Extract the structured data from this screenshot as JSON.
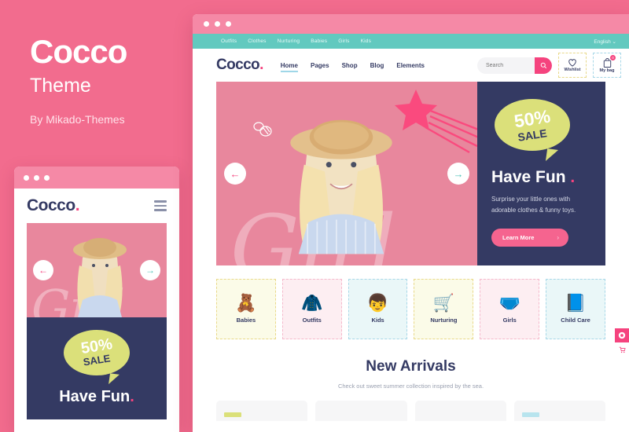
{
  "promo": {
    "title": "Cocco",
    "subtitle": "Theme",
    "author": "By Mikado-Themes"
  },
  "colors": {
    "background_pink": "#f26c8e",
    "navy": "#343a63",
    "accent_pink": "#f5437e",
    "teal": "#62c9bf",
    "lime": "#dbe07a"
  },
  "mobile": {
    "logo": "Cocco",
    "logo_dot": ".",
    "menu_icon": "hamburger-icon",
    "hero_word": "Girl",
    "prev_icon": "←",
    "next_icon": "→",
    "sale_percent": "50%",
    "sale_label": "SALE",
    "heading": "Have Fun",
    "heading_dot": "."
  },
  "browser": {
    "topbar": {
      "links": [
        "Outfits",
        "Clothes",
        "Nurturing",
        "Babies",
        "Girls",
        "Kids"
      ],
      "language": "English ⌄"
    },
    "header": {
      "logo": "Cocco",
      "logo_dot": ".",
      "nav": [
        {
          "label": "Home",
          "active": true
        },
        {
          "label": "Pages",
          "active": false
        },
        {
          "label": "Shop",
          "active": false
        },
        {
          "label": "Blog",
          "active": false
        },
        {
          "label": "Elements",
          "active": false
        }
      ],
      "search_placeholder": "Search",
      "search_value": "",
      "wishlist_label": "Wishlist",
      "bag_label": "My bag",
      "bag_count": "0"
    },
    "hero": {
      "word": "Girl",
      "prev_icon": "←",
      "next_icon": "→",
      "sale_percent": "50%",
      "sale_label": "SALE",
      "heading": "Have Fun",
      "heading_dot": ".",
      "paragraph": "Surprise your little ones with adorable clothes & funny toys.",
      "button_label": "Learn More",
      "button_arrow": "›"
    },
    "categories": [
      {
        "name": "Babies",
        "glyph": "🧸",
        "bg": "#fbfbe8",
        "border": "#e9d98a"
      },
      {
        "name": "Outfits",
        "glyph": "🧥",
        "bg": "#fdeef2",
        "border": "#f5b9cb"
      },
      {
        "name": "Kids",
        "glyph": "👦",
        "bg": "#eaf7f8",
        "border": "#a8d8e8"
      },
      {
        "name": "Nurturing",
        "glyph": "🛒",
        "bg": "#fbfbe8",
        "border": "#e9d98a"
      },
      {
        "name": "Girls",
        "glyph": "🩲",
        "bg": "#fdeef2",
        "border": "#f5b9cb"
      },
      {
        "name": "Child Care",
        "glyph": "📘",
        "bg": "#eaf7f8",
        "border": "#a8d8e8"
      }
    ],
    "arrivals": {
      "title": "New Arrivals",
      "subtitle": "Check out sweet summer collection inspired by the sea."
    },
    "products": [
      {
        "tag_color": "#dbe07a"
      },
      {
        "tag_color": "#f6f6f7"
      },
      {
        "tag_color": "#f6f6f7"
      },
      {
        "tag_color": "#b8e4ee"
      }
    ],
    "sidetab": {
      "top_icon": "settings-icon",
      "bottom_icon": "cart-icon"
    }
  }
}
